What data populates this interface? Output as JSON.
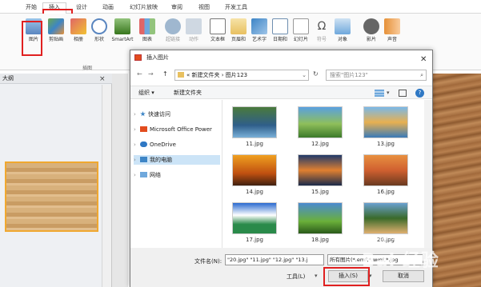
{
  "ribbon_tabs": [
    "开始",
    "插入",
    "设计",
    "动画",
    "幻灯片放映",
    "审阅",
    "视图",
    "开发工具"
  ],
  "ribbon_buttons": [
    "图片",
    "剪贴画",
    "相册",
    "形状",
    "SmartArt",
    "图表",
    "超链接",
    "动作",
    "文本框",
    "页眉和",
    "艺术字",
    "日期和",
    "幻灯片",
    "符号",
    "对象",
    "影片",
    "声音"
  ],
  "ribbon_group_label": "插图",
  "left_pane": {
    "title": "大纲",
    "close": "×"
  },
  "dialog": {
    "title": "插入图片",
    "close": "✕",
    "nav_back": "←",
    "nav_forward": "→",
    "nav_up": "↑",
    "address_path": "« 新建文件夹 › 图片123",
    "refresh": "↻",
    "search_placeholder": "搜索\"图片123\"",
    "organize": "组织 ▾",
    "new_folder": "新建文件夹",
    "nav_items": [
      {
        "label": "快速访问",
        "icon": "star-icon"
      },
      {
        "label": "Microsoft Office Power",
        "icon": "office-icon"
      },
      {
        "label": "OneDrive",
        "icon": "cloud-icon"
      },
      {
        "label": "我的电脑",
        "icon": "computer-icon"
      },
      {
        "label": "网络",
        "icon": "network-icon"
      }
    ],
    "files": [
      "11.jpg",
      "12.jpg",
      "13.jpg",
      "14.jpg",
      "15.jpg",
      "16.jpg",
      "17.jpg",
      "18.jpg",
      "20.jpg"
    ],
    "filename_label": "文件名(N):",
    "filename_value": "\"20.jpg\" \"11.jpg\" \"12.jpg\" \"13.j",
    "filetype_value": "所有图片(*.emf;*.wmf;*.jpg",
    "tools_label": "工具(L)",
    "insert_label": "插入(S)",
    "cancel_label": "取消"
  },
  "watermark": {
    "text": "Bai  经验",
    "sub": "jingyan.baidu.com"
  },
  "colors": {
    "accent_red": "#e02020",
    "dialog_border": "#7a7a7a"
  }
}
